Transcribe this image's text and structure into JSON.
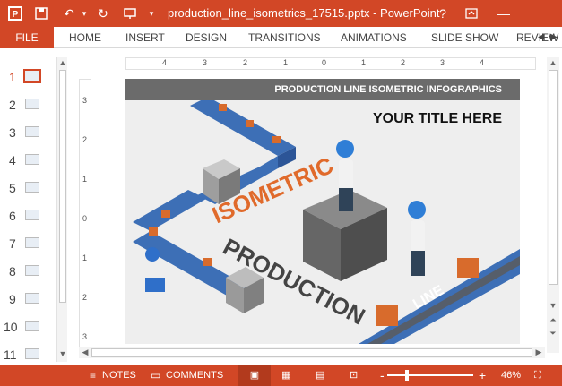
{
  "window": {
    "title": "production_line_isometrics_17515.pptx - PowerPoint",
    "controls": [
      "?",
      "↥",
      "—"
    ]
  },
  "quick_access": {
    "save_icon": "save-icon",
    "undo_icon": "undo-icon",
    "redo_icon": "redo-icon",
    "present_icon": "present-from-start-icon"
  },
  "ribbon": {
    "tabs": [
      "FILE",
      "HOME",
      "INSERT",
      "DESIGN",
      "TRANSITIONS",
      "ANIMATIONS",
      "SLIDE SHOW",
      "REVIEW"
    ]
  },
  "thumbnails": {
    "active": 1,
    "numbers": [
      "1",
      "2",
      "3",
      "4",
      "5",
      "6",
      "7",
      "8",
      "9",
      "10",
      "11"
    ]
  },
  "rulers": {
    "horizontal": [
      "4",
      "3",
      "2",
      "1",
      "0",
      "1",
      "2",
      "3",
      "4"
    ],
    "vertical": [
      "3",
      "2",
      "1",
      "0",
      "1",
      "2",
      "3"
    ]
  },
  "slide": {
    "band_text": "PRODUCTION LINE ISOMETRIC INFOGRAPHICS",
    "title": "YOUR TITLE HERE",
    "words": {
      "isometric": "ISOMETRIC",
      "production": "PRODUCTION",
      "line": "LINE"
    }
  },
  "status": {
    "notes": "NOTES",
    "comments": "COMMENTS",
    "zoom_minus": "-",
    "zoom_plus": "+",
    "zoom": "46%"
  },
  "colors": {
    "accent": "#d24726",
    "conveyor": "#3d6fb6",
    "box": "#d86b2c",
    "isometric_text": "#e06a2b",
    "production_text": "#444444"
  }
}
